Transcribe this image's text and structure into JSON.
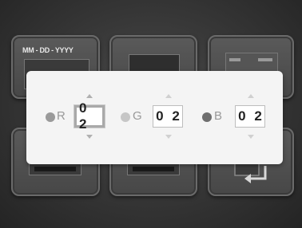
{
  "background_tiles": {
    "date_format_label": "MM - DD - YYYY",
    "icons": [
      "calendar-tile-icon",
      "image-tile-icon",
      "window-tile-icon",
      "folder-tile-icon",
      "folder-tile-icon",
      "return-tile-icon"
    ]
  },
  "rgb_adjust": {
    "active_channel": "R",
    "channels": [
      {
        "letter": "R",
        "value": "0 2",
        "dot_color": "#9a9a9a"
      },
      {
        "letter": "G",
        "value": "0 2",
        "dot_color": "#c6c6c6"
      },
      {
        "letter": "B",
        "value": "0 2",
        "dot_color": "#6e6e6e"
      }
    ]
  },
  "colors": {
    "overlay_bg": "#f4f4f4",
    "value_text": "#222222",
    "tile_bg": "#4f4f4f"
  }
}
